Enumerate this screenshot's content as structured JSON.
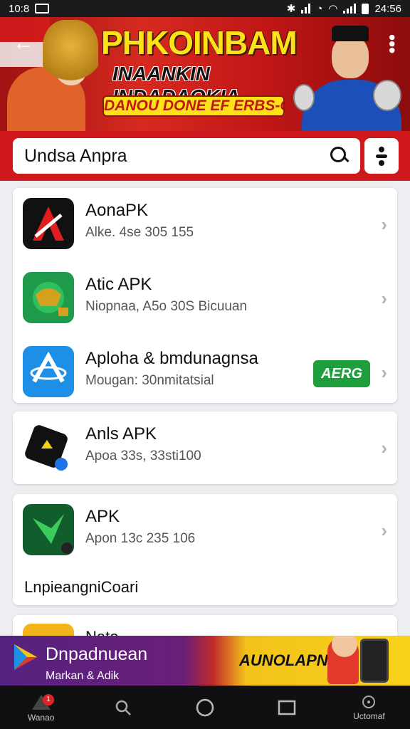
{
  "status_bar": {
    "time": "10:8",
    "clock_right": "24:56"
  },
  "banner": {
    "title_main": "PHKOINBAM",
    "title_sub": "INAANKIN INDADAOKIA",
    "pill_text": "DANOU DONE EF ERBS-OAIR"
  },
  "search": {
    "value": "Undsa Anpra"
  },
  "apps": [
    {
      "name": "AonaPK",
      "subtitle": "Alke. 4se 305 155"
    },
    {
      "name": "Atic APK",
      "subtitle": "Niopnaa, A5o 30S  Bicuuan"
    },
    {
      "name": "Aploha & bmdunagnsa",
      "subtitle": "Mougan: 30nmitatsial",
      "badge": "AERG"
    },
    {
      "name": "Anls APK",
      "subtitle": "Apoa 33s, 33sti100"
    },
    {
      "name": "APK",
      "subtitle": "Apon 13c 235 106",
      "footer": "LnpieangniCoari"
    }
  ],
  "partial_app": {
    "name": "Nato"
  },
  "ad": {
    "title": "Dnpadnuean",
    "subtitle": "Markan & Adik",
    "cta": "AUNOLAPN"
  },
  "nav": {
    "home_label": "Wanao",
    "home_badge": "1",
    "settings_label": "Uctomaf"
  },
  "colors": {
    "accent_red": "#d0191c",
    "badge_green": "#1f9e3d",
    "banner_yellow": "#ffe11a"
  }
}
